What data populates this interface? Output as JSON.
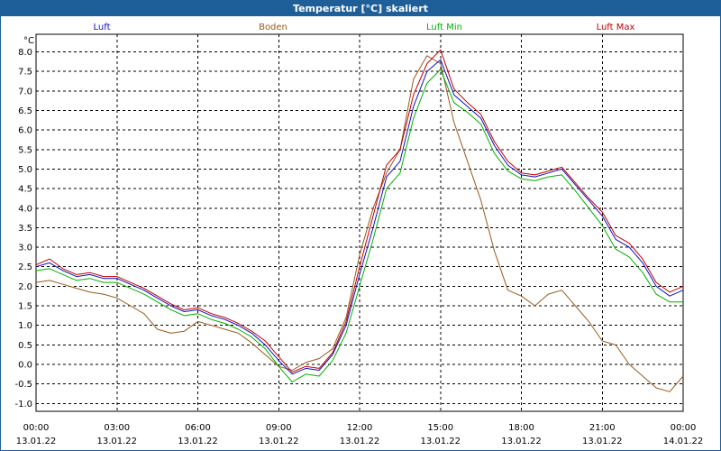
{
  "window": {
    "title": "Temperatur [°C] skaliert"
  },
  "chart_data": {
    "type": "line",
    "title": "Temperatur [°C] skaliert",
    "ylabel": "°C",
    "xlabel": "",
    "ylim": [
      -1.2,
      8.45
    ],
    "yticks": [
      -1.0,
      -0.5,
      0.0,
      0.5,
      1.0,
      1.5,
      2.0,
      2.5,
      3.0,
      3.5,
      4.0,
      4.5,
      5.0,
      5.5,
      6.0,
      6.5,
      7.0,
      7.5,
      8.0
    ],
    "ytick_labels": [
      "-1.0",
      "-0.5",
      "0.0",
      "0.5",
      "1.0",
      "1.5",
      "2.0",
      "2.5",
      "3.0",
      "3.5",
      "4.0",
      "4.5",
      "5.0",
      "5.5",
      "6.0",
      "6.5",
      "7.0",
      "7.5",
      "8.0"
    ],
    "xlim": [
      "13.01.22 00:00",
      "14.01.22 00:00"
    ],
    "xticks": [
      {
        "time": "00:00",
        "date": "13.01.22"
      },
      {
        "time": "03:00",
        "date": "13.01.22"
      },
      {
        "time": "06:00",
        "date": "13.01.22"
      },
      {
        "time": "09:00",
        "date": "13.01.22"
      },
      {
        "time": "12:00",
        "date": "13.01.22"
      },
      {
        "time": "15:00",
        "date": "13.01.22"
      },
      {
        "time": "18:00",
        "date": "13.01.22"
      },
      {
        "time": "21:00",
        "date": "13.01.22"
      },
      {
        "time": "00:00",
        "date": "14.01.22"
      }
    ],
    "grid": true,
    "legend_position": "top",
    "series": [
      {
        "name": "Luft",
        "color": "#1010c0",
        "x": [
          0,
          0.5,
          1,
          1.5,
          2,
          2.5,
          3,
          3.5,
          4,
          4.5,
          5,
          5.5,
          6,
          6.5,
          7,
          7.5,
          8,
          8.5,
          9,
          9.5,
          10,
          10.5,
          11,
          11.5,
          12,
          12.5,
          13,
          13.5,
          14,
          14.5,
          15,
          15.5,
          16,
          16.5,
          17,
          17.5,
          18,
          18.5,
          19,
          19.5,
          20,
          20.5,
          21,
          21.5,
          22,
          22.5,
          23,
          23.5,
          24
        ],
        "y": [
          2.5,
          2.6,
          2.4,
          2.25,
          2.3,
          2.2,
          2.2,
          2.05,
          1.9,
          1.7,
          1.5,
          1.35,
          1.4,
          1.25,
          1.15,
          1.0,
          0.8,
          0.5,
          0.1,
          -0.25,
          -0.1,
          -0.15,
          0.25,
          1.0,
          2.3,
          3.5,
          4.8,
          5.2,
          6.6,
          7.5,
          7.8,
          6.9,
          6.6,
          6.3,
          5.6,
          5.1,
          4.85,
          4.8,
          4.9,
          5.0,
          4.6,
          4.2,
          3.8,
          3.2,
          3.0,
          2.6,
          2.0,
          1.75,
          1.9
        ]
      },
      {
        "name": "Boden",
        "color": "#9a5a1a",
        "x": [
          0,
          0.5,
          1,
          1.5,
          2,
          2.5,
          3,
          3.5,
          4,
          4.5,
          5,
          5.5,
          6,
          6.5,
          7,
          7.5,
          8,
          8.5,
          9,
          9.5,
          10,
          10.5,
          11,
          11.5,
          12,
          12.5,
          13,
          13.5,
          14,
          14.5,
          15,
          15.5,
          16,
          16.5,
          17,
          17.5,
          18,
          18.5,
          19,
          19.5,
          20,
          20.5,
          21,
          21.5,
          22,
          22.5,
          23,
          23.5,
          24
        ],
        "y": [
          2.1,
          2.15,
          2.05,
          1.95,
          1.85,
          1.8,
          1.7,
          1.5,
          1.3,
          0.9,
          0.8,
          0.85,
          1.1,
          1.0,
          0.9,
          0.8,
          0.55,
          0.25,
          -0.05,
          -0.15,
          0.05,
          0.15,
          0.4,
          1.2,
          2.8,
          4.0,
          4.9,
          5.5,
          7.3,
          7.9,
          7.7,
          6.2,
          5.2,
          4.2,
          2.9,
          1.9,
          1.75,
          1.5,
          1.8,
          1.9,
          1.5,
          1.1,
          0.6,
          0.5,
          0.0,
          -0.3,
          -0.6,
          -0.7,
          -0.3
        ]
      },
      {
        "name": "Luft Min",
        "color": "#00b000",
        "x": [
          0,
          0.5,
          1,
          1.5,
          2,
          2.5,
          3,
          3.5,
          4,
          4.5,
          5,
          5.5,
          6,
          6.5,
          7,
          7.5,
          8,
          8.5,
          9,
          9.5,
          10,
          10.5,
          11,
          11.5,
          12,
          12.5,
          13,
          13.5,
          14,
          14.5,
          15,
          15.5,
          16,
          16.5,
          17,
          17.5,
          18,
          18.5,
          19,
          19.5,
          20,
          20.5,
          21,
          21.5,
          22,
          22.5,
          23,
          23.5,
          24
        ],
        "y": [
          2.4,
          2.45,
          2.3,
          2.15,
          2.2,
          2.1,
          2.1,
          1.95,
          1.8,
          1.6,
          1.4,
          1.25,
          1.3,
          1.15,
          1.05,
          0.9,
          0.7,
          0.4,
          -0.05,
          -0.45,
          -0.25,
          -0.3,
          0.1,
          0.8,
          2.0,
          3.2,
          4.5,
          4.9,
          6.3,
          7.2,
          7.55,
          6.7,
          6.45,
          6.15,
          5.4,
          4.95,
          4.75,
          4.7,
          4.8,
          4.85,
          4.45,
          4.0,
          3.55,
          2.95,
          2.75,
          2.35,
          1.8,
          1.6,
          1.6
        ]
      },
      {
        "name": "Luft Max",
        "color": "#c00000",
        "x": [
          0,
          0.5,
          1,
          1.5,
          2,
          2.5,
          3,
          3.5,
          4,
          4.5,
          5,
          5.5,
          6,
          6.5,
          7,
          7.5,
          8,
          8.5,
          9,
          9.5,
          10,
          10.5,
          11,
          11.5,
          12,
          12.5,
          13,
          13.5,
          14,
          14.5,
          15,
          15.5,
          16,
          16.5,
          17,
          17.5,
          18,
          18.5,
          19,
          19.5,
          20,
          20.5,
          21,
          21.5,
          22,
          22.5,
          23,
          23.5,
          24
        ],
        "y": [
          2.55,
          2.7,
          2.45,
          2.3,
          2.35,
          2.25,
          2.25,
          2.1,
          1.95,
          1.75,
          1.55,
          1.4,
          1.45,
          1.3,
          1.2,
          1.05,
          0.85,
          0.6,
          0.2,
          -0.2,
          -0.05,
          -0.1,
          0.3,
          1.1,
          2.5,
          3.8,
          5.1,
          5.5,
          6.9,
          7.7,
          8.05,
          7.05,
          6.7,
          6.4,
          5.7,
          5.2,
          4.9,
          4.85,
          4.95,
          5.05,
          4.65,
          4.25,
          3.9,
          3.3,
          3.1,
          2.7,
          2.1,
          1.85,
          2.0
        ]
      }
    ]
  }
}
